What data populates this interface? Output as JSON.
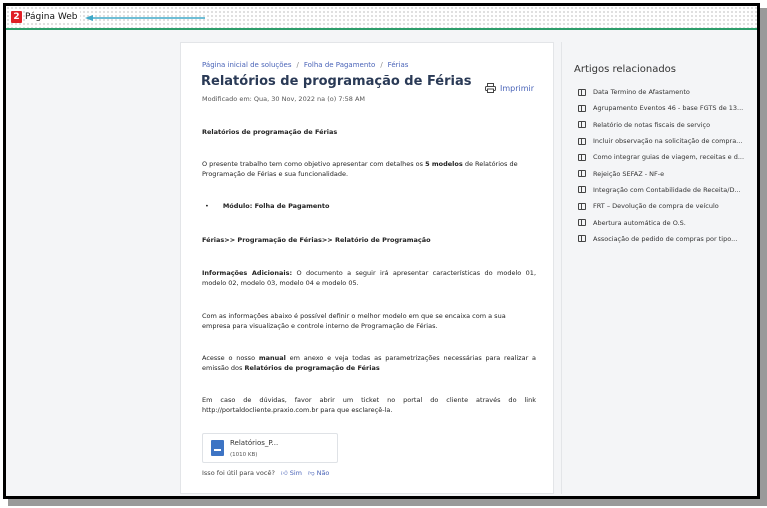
{
  "topbar": {
    "logo_letter": "2",
    "site_title": "Página Web"
  },
  "article": {
    "breadcrumb": [
      "Página inicial de soluções",
      "Folha de Pagamento",
      "Férias"
    ],
    "title": "Relatórios de programação de Férias",
    "modified": "Modificado em: Qua, 30 Nov, 2022 na (o) 7:58 AM",
    "print_label": "Imprimir",
    "heading1": "Relatórios de programação de Férias",
    "intro_pre": "O presente trabalho tem como objetivo apresentar com detalhes os ",
    "intro_bold": "5 modelos",
    "intro_post": " de Relatórios de Programação de Férias e sua funcionalidade.",
    "bullet": "Módulo: Folha de Pagamento",
    "path": "Férias>> Programação de Férias>> Relatório de Programação",
    "info_bold": "Informações Adicionais:",
    "info_text": " O documento a seguir irá apresentar características do modelo 01, modelo 02, modelo 03, modelo 04 e modelo 05.",
    "para2": "Com as informações abaixo é possível definir o melhor modelo em que se encaixa com a sua empresa para visualização e controle interno de Programação de Férias.",
    "para3_pre": "Acesse o nosso ",
    "para3_bold": "manual",
    "para3_mid": " em anexo e veja todas as parametrizações necessárias para realizar a emissão dos ",
    "para3_bold2": "Relatórios de programação de Férias",
    "para4": "Em caso de dúvidas, favor abrir um ticket no portal do cliente através do link http://portaldocliente.praxio.com.br para que esclareçê-la.",
    "attachment": {
      "name": "Relatórios_P...",
      "size": "(1010 KB)"
    },
    "feedback": {
      "question": "Isso foi útil para você?",
      "yes": "Sim",
      "no": "Não"
    }
  },
  "related": {
    "title": "Artigos relacionados",
    "items": [
      "Data Termino de Afastamento",
      "Agrupamento Eventos 46 - base FGTS de 13...",
      "Relatório de notas fiscais de serviço",
      "Incluir observação na solicitação de compra...",
      "Como integrar guias de viagem, receitas e d...",
      "Rejeição SEFAZ - NF-e",
      "Integração com Contabilidade de Receita/D...",
      "FRT – Devolução de compra de veículo",
      "Abertura automática de O.S.",
      "Associação de pedido de compras por tipo..."
    ]
  },
  "colors": {
    "accent": "#4a64b8",
    "brand_red": "#e01f26",
    "topbar_line": "#2e9e6b",
    "annotation_arrow": "#3fa9c9"
  }
}
